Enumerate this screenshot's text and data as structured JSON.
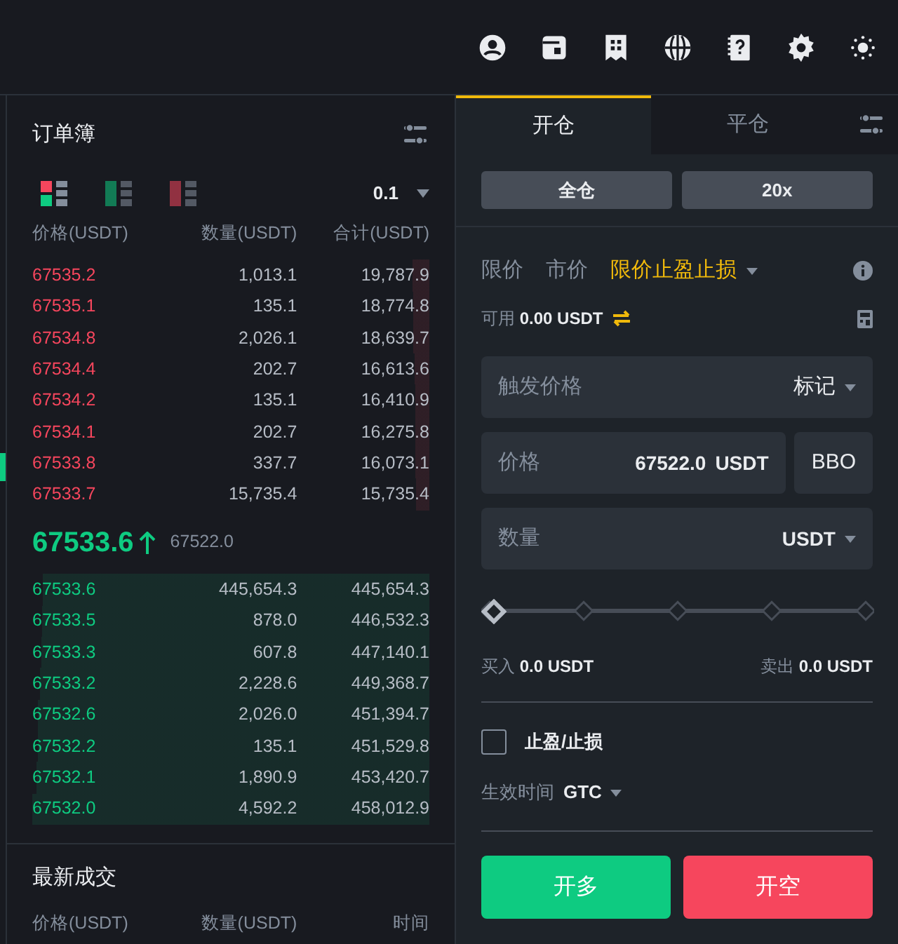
{
  "order_book": {
    "title": "订单簿",
    "views": [
      {
        "kind": "both",
        "selected": true
      },
      {
        "kind": "bids",
        "selected": false
      },
      {
        "kind": "asks",
        "selected": false
      }
    ],
    "precision": "0.1",
    "columns": [
      "价格(USDT)",
      "数量(USDT)",
      "合计(USDT)"
    ],
    "asks": [
      {
        "price": "67535.2",
        "amount": "1,013.1",
        "total": "19,787.9"
      },
      {
        "price": "67535.1",
        "amount": "135.1",
        "total": "18,774.8"
      },
      {
        "price": "67534.8",
        "amount": "2,026.1",
        "total": "18,639.7"
      },
      {
        "price": "67534.4",
        "amount": "202.7",
        "total": "16,613.6"
      },
      {
        "price": "67534.2",
        "amount": "135.1",
        "total": "16,410.9"
      },
      {
        "price": "67534.1",
        "amount": "202.7",
        "total": "16,275.8"
      },
      {
        "price": "67533.8",
        "amount": "337.7",
        "total": "16,073.1"
      },
      {
        "price": "67533.7",
        "amount": "15,735.4",
        "total": "15,735.4"
      }
    ],
    "last_price": "67533.6",
    "mark_price": "67522.0",
    "bids": [
      {
        "price": "67533.6",
        "amount": "445,654.3",
        "total": "445,654.3"
      },
      {
        "price": "67533.5",
        "amount": "878.0",
        "total": "446,532.3"
      },
      {
        "price": "67533.3",
        "amount": "607.8",
        "total": "447,140.1"
      },
      {
        "price": "67533.2",
        "amount": "2,228.6",
        "total": "449,368.7"
      },
      {
        "price": "67532.6",
        "amount": "2,026.0",
        "total": "451,394.7"
      },
      {
        "price": "67532.2",
        "amount": "135.1",
        "total": "451,529.8"
      },
      {
        "price": "67532.1",
        "amount": "1,890.9",
        "total": "453,420.7"
      },
      {
        "price": "67532.0",
        "amount": "4,592.2",
        "total": "458,012.9"
      }
    ]
  },
  "recent_trades": {
    "title": "最新成交",
    "columns": [
      "价格(USDT)",
      "数量(USDT)",
      "时间"
    ]
  },
  "trade_panel": {
    "tabs": [
      {
        "label": "开仓",
        "selected": true
      },
      {
        "label": "平仓",
        "selected": false
      }
    ],
    "margin_mode": "全仓",
    "leverage": "20x",
    "order_types": [
      {
        "label": "限价",
        "selected": false,
        "dropdown": false
      },
      {
        "label": "市价",
        "selected": false,
        "dropdown": false
      },
      {
        "label": "限价止盈止损",
        "selected": true,
        "dropdown": true
      }
    ],
    "available_label": "可用",
    "available": "0.00 USDT",
    "trigger": {
      "placeholder": "触发价格",
      "option": "标记"
    },
    "price": {
      "label": "价格",
      "value": "67522.0",
      "unit": "USDT",
      "bbo": "BBO"
    },
    "quantity": {
      "placeholder": "数量",
      "unit": "USDT"
    },
    "slider": {
      "level": 0
    },
    "buy_label": "买入",
    "buy_value": "0.0 USDT",
    "sell_label": "卖出",
    "sell_value": "0.0 USDT",
    "tp_sl": {
      "label": "止盈/止损",
      "checked": false
    },
    "tif_label": "生效时间",
    "tif": "GTC",
    "long_button": "开多",
    "short_button": "开空"
  }
}
